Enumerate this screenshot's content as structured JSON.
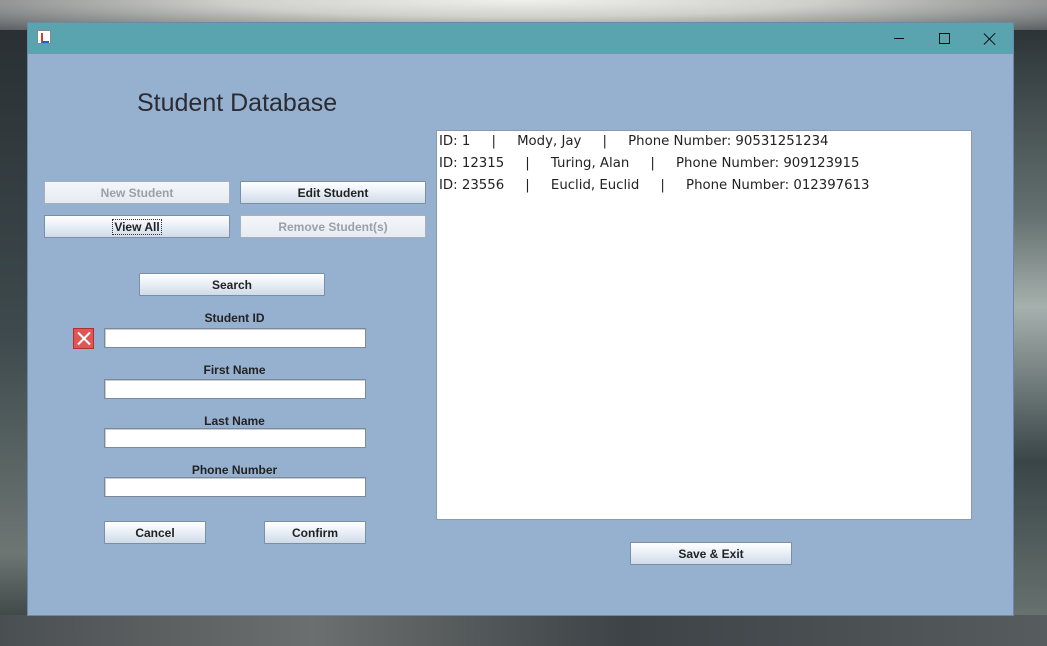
{
  "window": {
    "title": "",
    "controls": {
      "minimize": "minimize",
      "maximize": "maximize",
      "close": "close"
    }
  },
  "header": {
    "title": "Student Database"
  },
  "actions": {
    "new_student": "New Student",
    "edit_student": "Edit Student",
    "view_all": "View All",
    "remove_students": "Remove Student(s)",
    "search": "Search"
  },
  "form": {
    "student_id": {
      "label": "Student ID",
      "value": ""
    },
    "first_name": {
      "label": "First Name",
      "value": ""
    },
    "last_name": {
      "label": "Last Name",
      "value": ""
    },
    "phone_number": {
      "label": "Phone Number",
      "value": ""
    },
    "cancel": "Cancel",
    "confirm": "Confirm"
  },
  "list": {
    "rows": [
      "ID: 1     |     Mody, Jay     |     Phone Number: 90531251234",
      "ID: 12315     |     Turing, Alan     |     Phone Number: 909123915",
      "ID: 23556     |     Euclid, Euclid     |     Phone Number: 012397613"
    ]
  },
  "footer": {
    "save_exit": "Save & Exit"
  },
  "colors": {
    "window_bg": "#96b1d0",
    "titlebar": "#5aa4b0",
    "error": "#e05555"
  }
}
